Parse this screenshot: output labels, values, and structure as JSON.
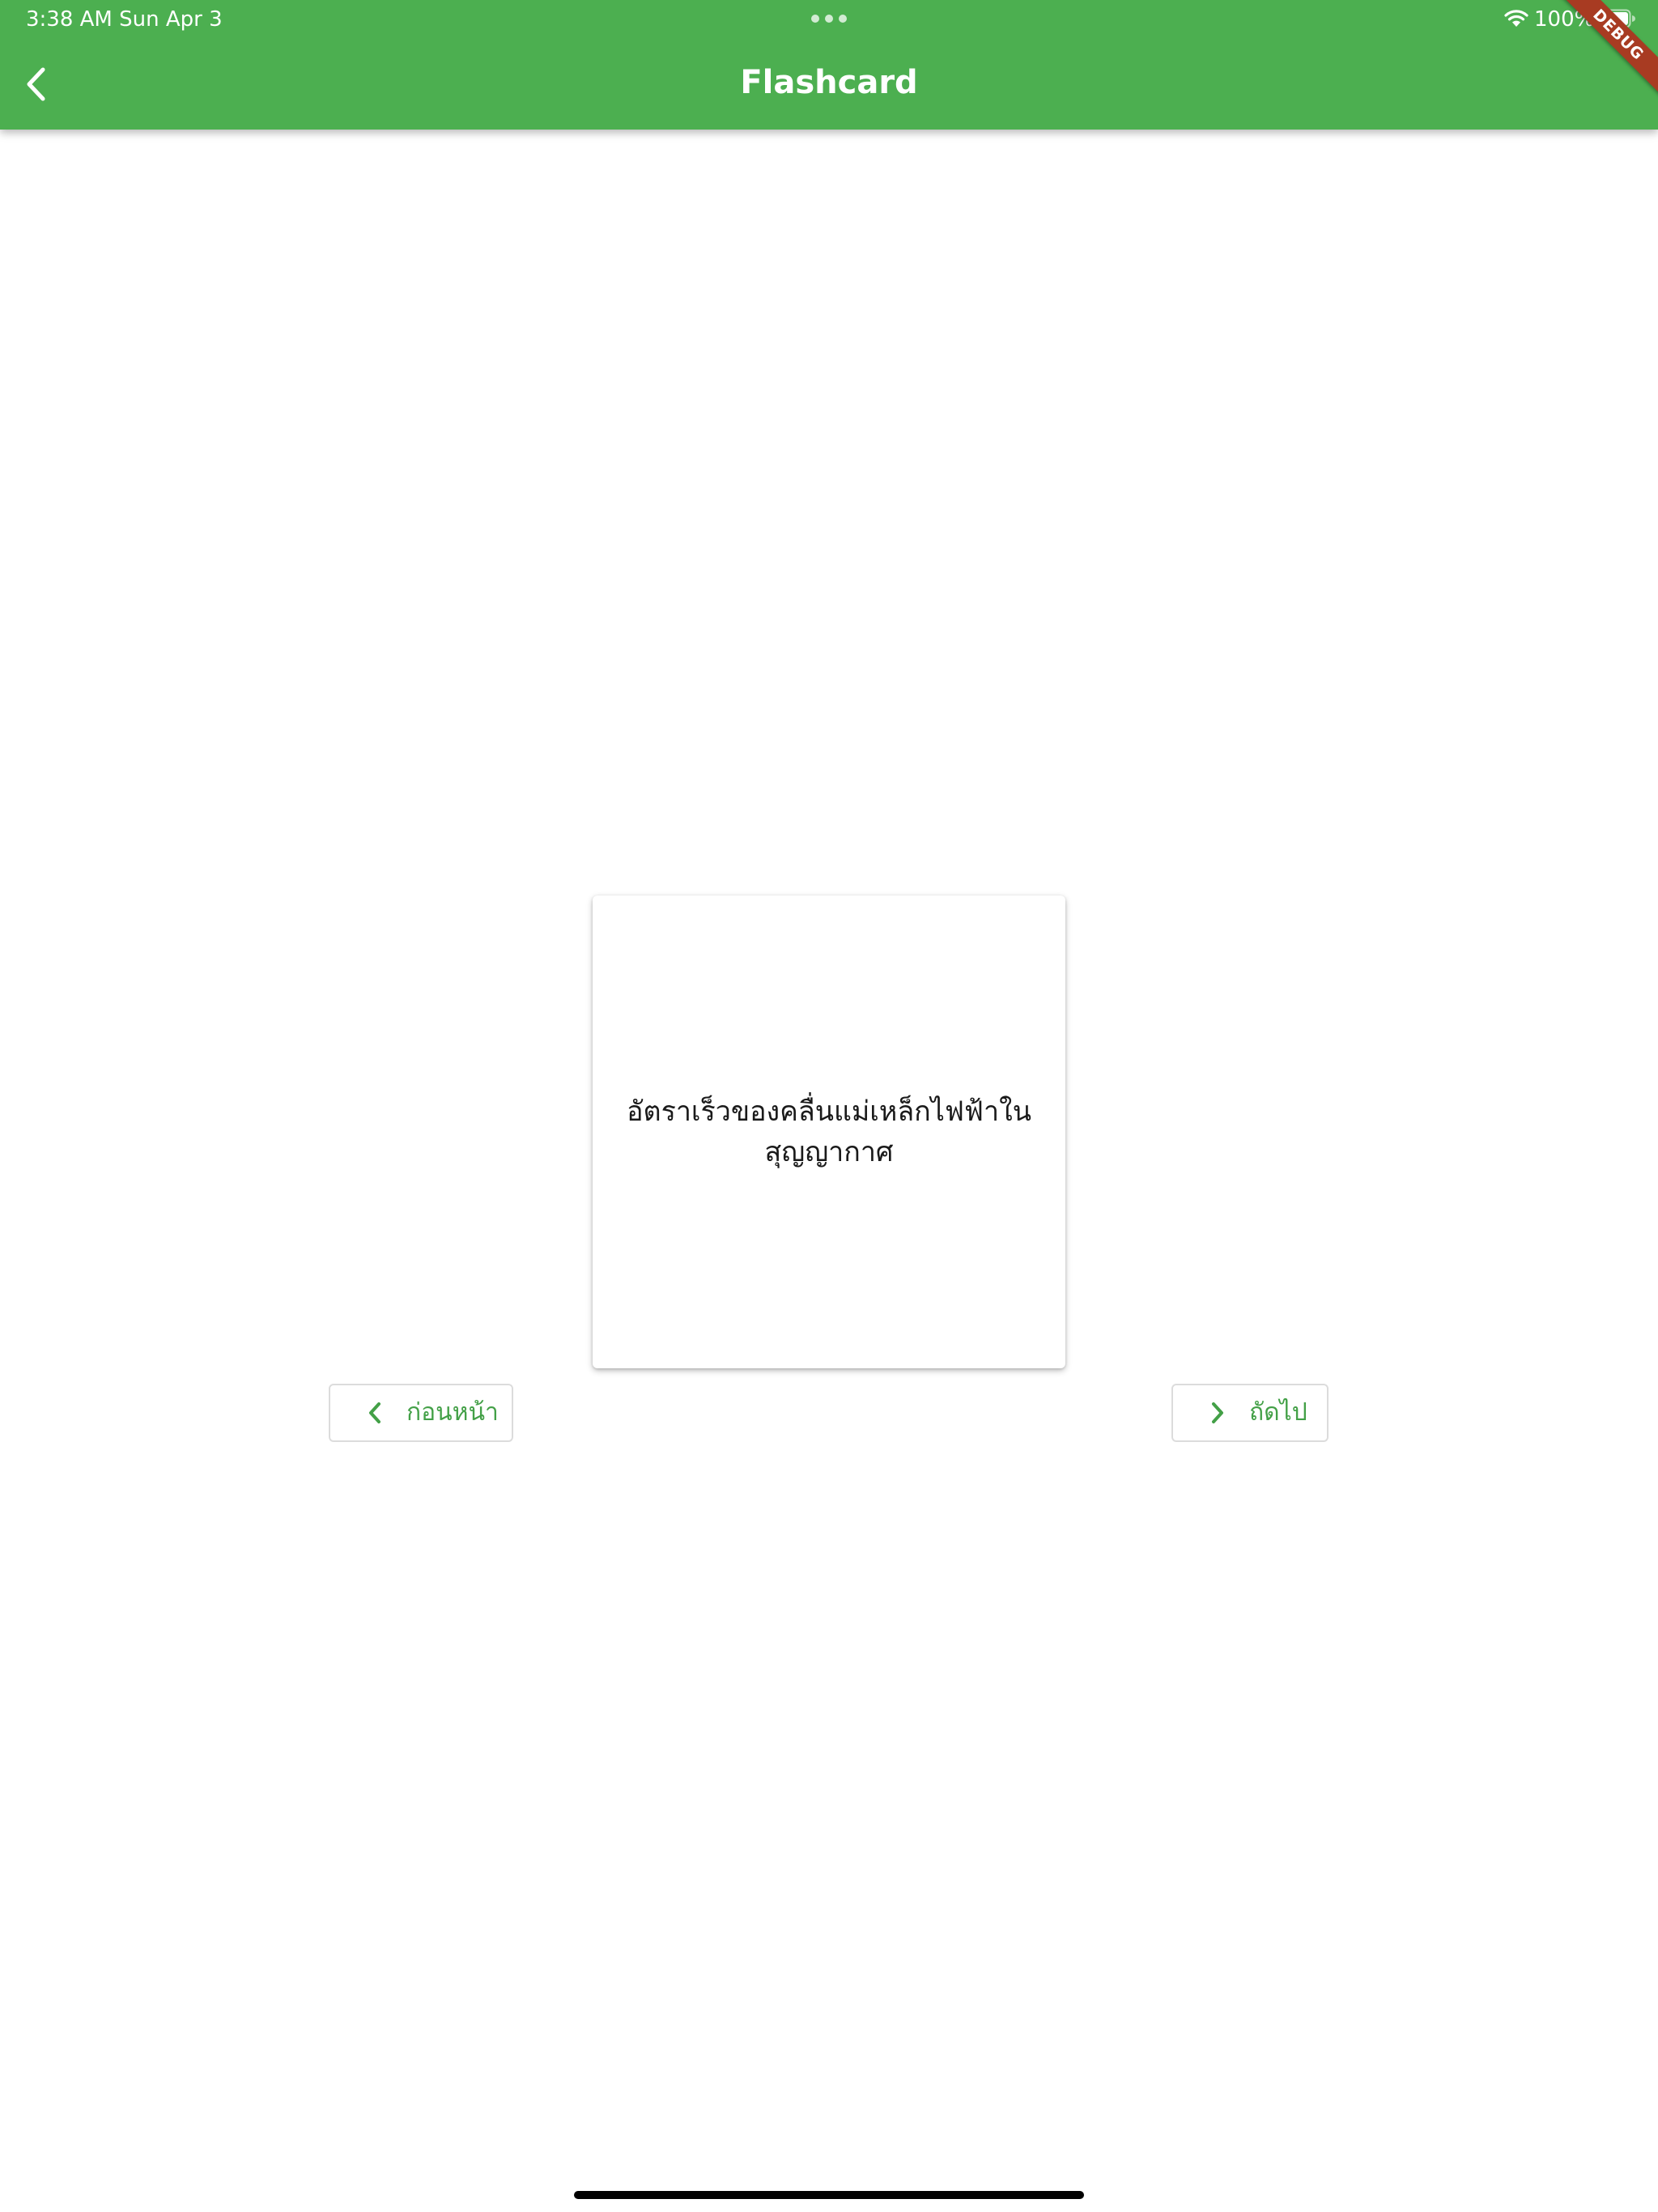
{
  "status_bar": {
    "time": "3:38 AM   Sun Apr 3",
    "battery_percent": "100%",
    "battery_level": 1.0
  },
  "app_bar": {
    "title": "Flashcard",
    "back_icon": "chevron-left-icon",
    "background_color": "#4caf50"
  },
  "debug_banner": {
    "label": "DEBUG",
    "color": "#a83b22"
  },
  "flashcard": {
    "text": "อัตราเร็วของคลื่นแม่เหล็กไฟฟ้าในสุญญากาศ"
  },
  "navigation": {
    "previous": {
      "label": "ก่อนหน้า",
      "icon": "chevron-left-icon"
    },
    "next": {
      "label": "ถัดไป",
      "icon": "chevron-right-icon"
    },
    "accent_color": "#43a047"
  }
}
